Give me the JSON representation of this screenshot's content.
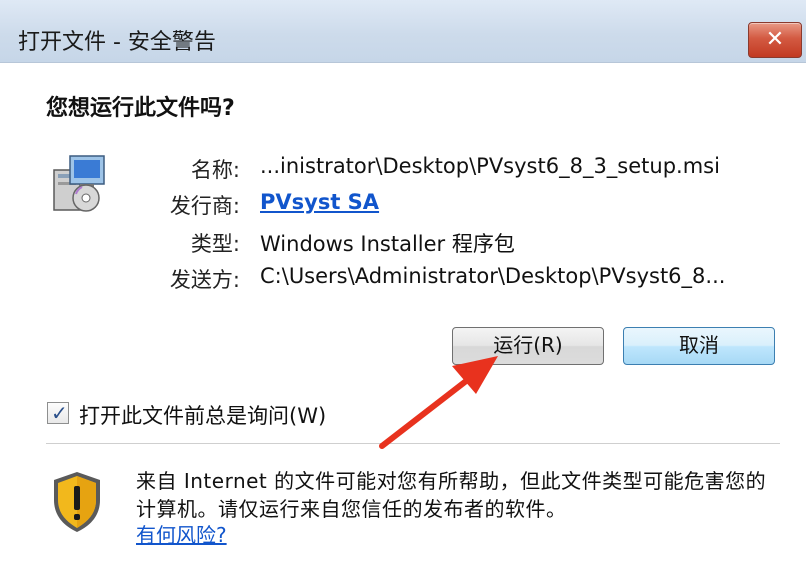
{
  "window": {
    "title": "打开文件 - 安全警告",
    "close_glyph": "✕"
  },
  "question": "您想运行此文件吗?",
  "file_info": [
    {
      "label": "名称:",
      "value": "...inistrator\\Desktop\\PVsyst6_8_3_setup.msi"
    },
    {
      "label": "发行商:",
      "value": "PVsyst SA"
    },
    {
      "label": "类型:",
      "value": "Windows Installer 程序包"
    },
    {
      "label": "发送方:",
      "value": "C:\\Users\\Administrator\\Desktop\\PVsyst6_8..."
    }
  ],
  "buttons": {
    "run": "运行(R)",
    "cancel": "取消"
  },
  "checkbox": {
    "checked": true,
    "label": "打开此文件前总是询问(W)"
  },
  "warning": {
    "text": "来自 Internet 的文件可能对您有所帮助，但此文件类型可能危害您的计算机。请仅运行来自您信任的发布者的软件。",
    "link": "有何风险?"
  },
  "icons": {
    "app": "installer-package-icon",
    "warning": "security-shield-icon"
  },
  "colors": {
    "link": "#1155cc",
    "annotation_arrow": "#e8321e",
    "close_button": "#c8432c"
  }
}
